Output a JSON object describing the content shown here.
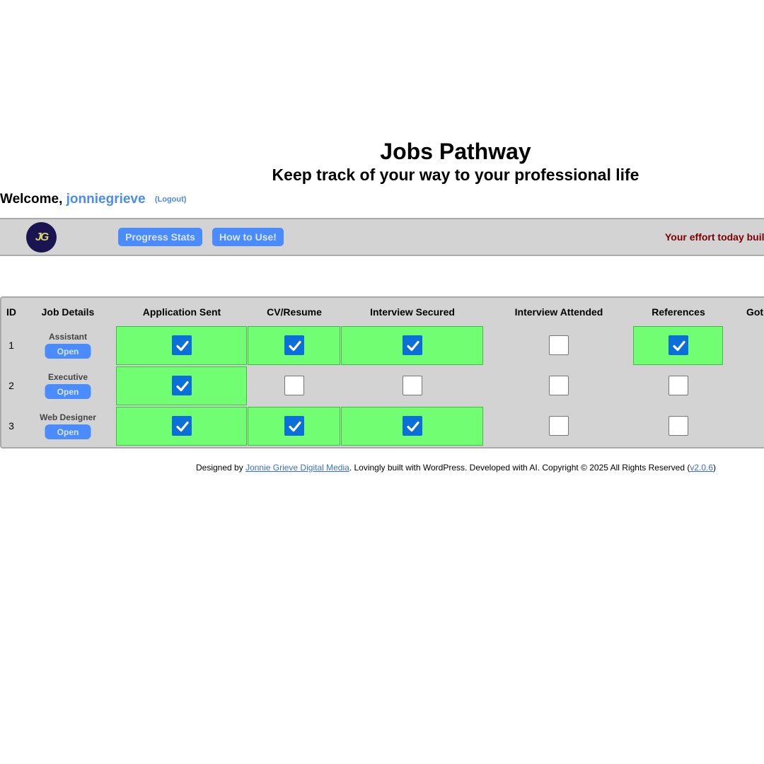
{
  "header": {
    "title": "Jobs Pathway",
    "subtitle": "Keep track of your way to your professional life"
  },
  "welcome": {
    "prefix": "Welcome,",
    "username": "jonniegrieve",
    "logout": "(Logout)"
  },
  "navbar": {
    "logo_text": "JG",
    "progress_stats": "Progress Stats",
    "how_to_use": "How to Use!",
    "motivation": "Your effort today buil"
  },
  "table": {
    "columns": {
      "id": "ID",
      "job_details": "Job Details",
      "application_sent": "Application Sent",
      "cv_resume": "CV/Resume",
      "interview_secured": "Interview Secured",
      "interview_attended": "Interview Attended",
      "references": "References",
      "got": "Got"
    },
    "open_label": "Open",
    "rows": [
      {
        "id": "1",
        "job": "Assistant",
        "application_sent": true,
        "cv_resume": true,
        "interview_secured": true,
        "interview_attended": false,
        "references": true
      },
      {
        "id": "2",
        "job": "Executive",
        "application_sent": true,
        "cv_resume": false,
        "interview_secured": false,
        "interview_attended": false,
        "references": false
      },
      {
        "id": "3",
        "job": "Web Designer",
        "application_sent": true,
        "cv_resume": true,
        "interview_secured": true,
        "interview_attended": false,
        "references": false
      }
    ]
  },
  "footer": {
    "designed_by": "Designed by",
    "company": "Jonnie Grieve Digital Media",
    "rest": ". Lovingly built with WordPress. Developed with AI. Copyright © 2025 All Rights Reserved (",
    "version": "v2.0.6",
    "close": ")"
  },
  "colors": {
    "accent_blue": "#4a8cff",
    "checked_green": "#72fe72",
    "panel_gray": "#d3d3d3",
    "motivation_red": "#7a0000"
  }
}
